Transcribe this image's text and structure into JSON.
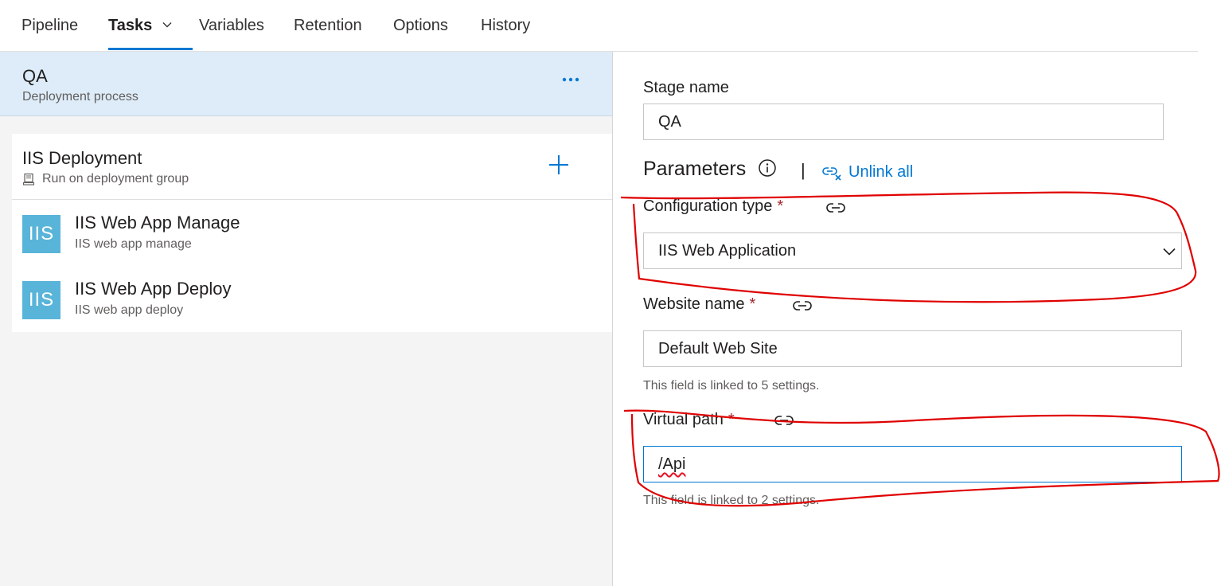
{
  "tabs": [
    {
      "label": "Pipeline"
    },
    {
      "label": "Tasks"
    },
    {
      "label": "Variables"
    },
    {
      "label": "Retention"
    },
    {
      "label": "Options"
    },
    {
      "label": "History"
    }
  ],
  "stage": {
    "title": "QA",
    "subtitle": "Deployment process"
  },
  "job": {
    "title": "IIS Deployment",
    "subtitle": "Run on deployment group"
  },
  "tasks": [
    {
      "icon_text": "IIS",
      "title": "IIS Web App Manage",
      "subtitle": "IIS web app manage"
    },
    {
      "icon_text": "IIS",
      "title": "IIS Web App Deploy",
      "subtitle": "IIS web app deploy"
    }
  ],
  "form": {
    "stage_name_label": "Stage name",
    "stage_name_value": "QA",
    "parameters_label": "Parameters",
    "separator": "|",
    "unlink_all": "Unlink all",
    "config_type_label": "Configuration type",
    "config_type_value": "IIS Web Application",
    "website_name_label": "Website name",
    "website_name_value": "Default Web Site",
    "website_name_hint": "This field is linked to 5 settings.",
    "virtual_path_label": "Virtual path",
    "virtual_path_value": "/Api",
    "virtual_path_hint": "This field is linked to 2 settings.",
    "required_marker": "*"
  },
  "colors": {
    "accent": "#0078d4",
    "selected_stage_bg": "#deecf9",
    "task_icon_bg": "#59b4d9",
    "required": "#a4262c",
    "annotation": "#e00000"
  }
}
